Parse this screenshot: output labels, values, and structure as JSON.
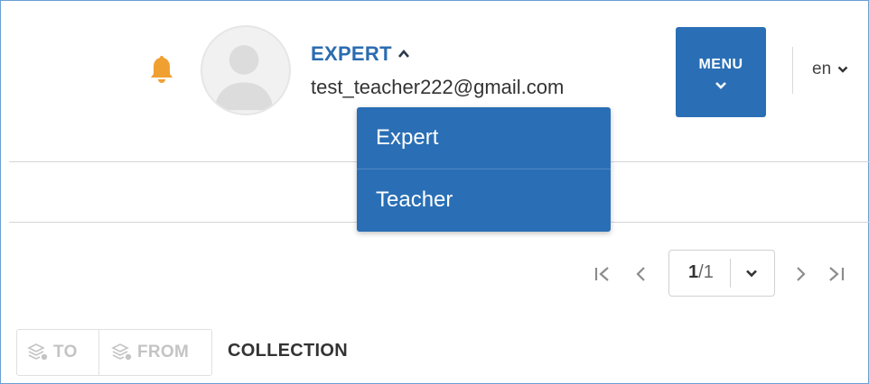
{
  "header": {
    "role": "EXPERT",
    "email": "test_teacher222@gmail.com",
    "menu_label": "MENU",
    "language": "en"
  },
  "role_dropdown": {
    "items": [
      {
        "label": "Expert"
      },
      {
        "label": "Teacher"
      }
    ]
  },
  "pagination": {
    "current": "1",
    "separator": "/",
    "total": "1"
  },
  "toolbar": {
    "to_label": "TO",
    "from_label": "FROM",
    "collection_label": "COLLECTION"
  },
  "colors": {
    "accent": "#2a6fb5",
    "bell": "#f0a030",
    "disabled": "#c4c4c4"
  },
  "icons": [
    "bell-icon",
    "avatar-placeholder-icon",
    "chevron-up-icon",
    "chevron-down-icon",
    "first-page-icon",
    "prev-page-icon",
    "next-page-icon",
    "last-page-icon",
    "stack-icon"
  ]
}
